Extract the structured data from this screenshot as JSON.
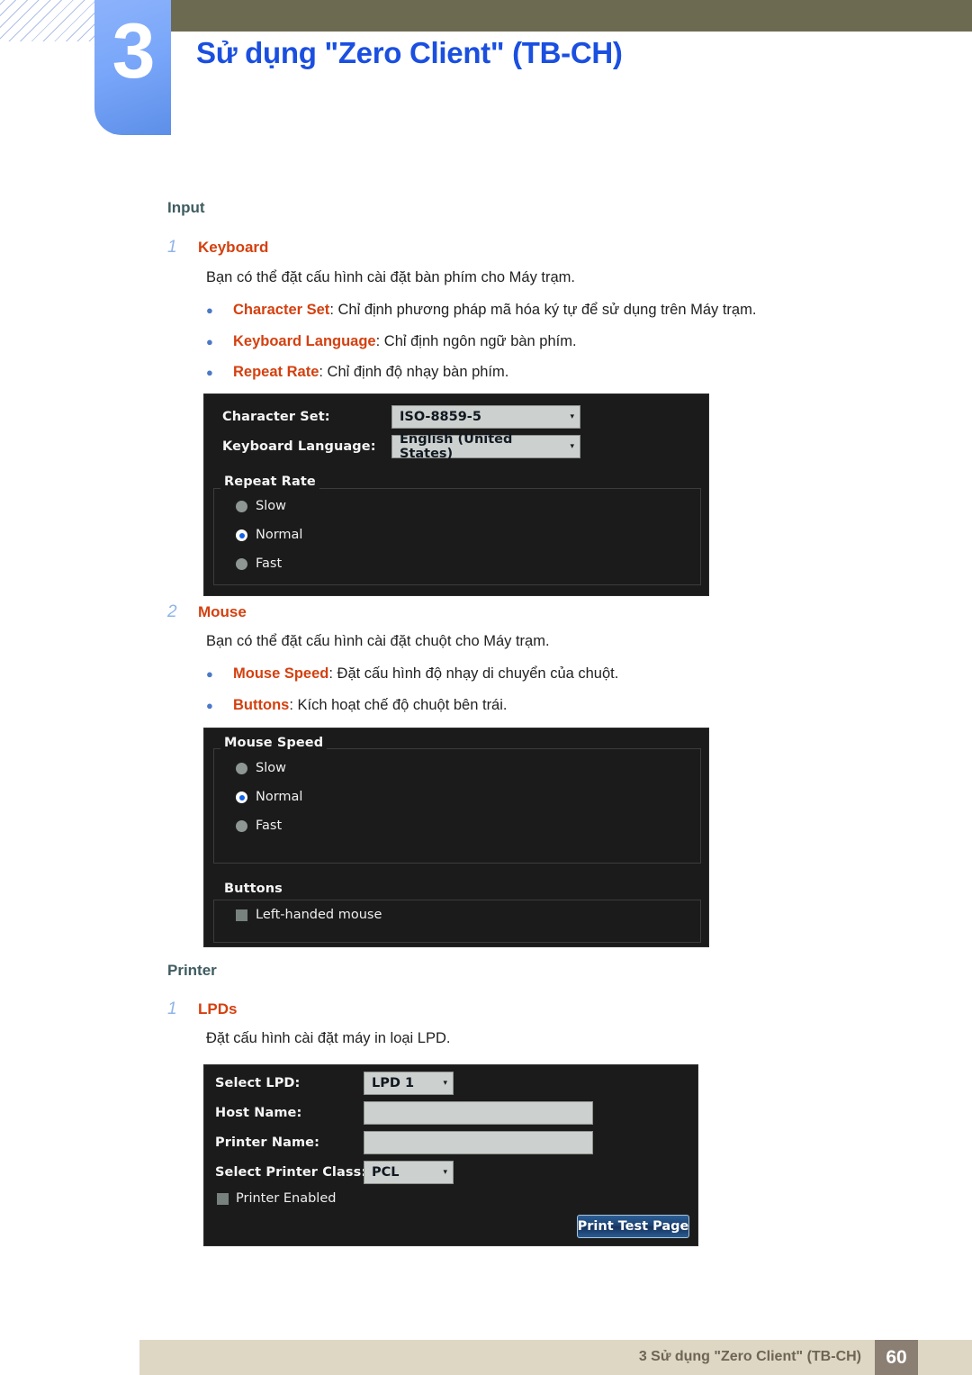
{
  "header": {
    "chapter_number": "3",
    "chapter_title": "Sử dụng \"Zero Client\" (TB-CH)",
    "accent_blue": "#1a4fe0",
    "olive": "#6d6a52"
  },
  "sections": [
    {
      "group_head": "Input",
      "items": [
        {
          "num": "1",
          "title": "Keyboard",
          "paragraph": "Bạn có thể đặt cấu hình cài đặt bàn phím cho Máy trạm.",
          "bullets": [
            {
              "term": "Character Set",
              "text": ": Chỉ định phương pháp mã hóa ký tự để sử dụng trên Máy trạm."
            },
            {
              "term": "Keyboard Language",
              "text": ": Chỉ định ngôn ngữ bàn phím."
            },
            {
              "term": "Repeat Rate",
              "text": ": Chỉ định độ nhạy bàn phím."
            }
          ]
        },
        {
          "num": "2",
          "title": "Mouse",
          "paragraph": "Bạn có thể đặt cấu hình cài đặt chuột cho Máy trạm.",
          "bullets": [
            {
              "term": "Mouse Speed",
              "text": ": Đặt cấu hình độ nhạy di chuyển của chuột."
            },
            {
              "term": "Buttons",
              "text": ": Kích hoạt chế độ chuột bên trái."
            }
          ]
        }
      ]
    },
    {
      "group_head": "Printer",
      "items": [
        {
          "num": "1",
          "title": "LPDs",
          "paragraph": "Đặt cấu hình cài đặt máy in loại LPD.",
          "bullets": []
        }
      ]
    }
  ],
  "keyboard_dialog": {
    "character_set_label": "Character Set:",
    "character_set_value": "ISO-8859-5",
    "keyboard_language_label": "Keyboard Language:",
    "keyboard_language_value": "English (United States)",
    "repeat_rate_legend": "Repeat Rate",
    "repeat_rate_options": [
      "Slow",
      "Normal",
      "Fast"
    ],
    "repeat_rate_selected": "Normal"
  },
  "mouse_dialog": {
    "mouse_speed_legend": "Mouse Speed",
    "mouse_speed_options": [
      "Slow",
      "Normal",
      "Fast"
    ],
    "mouse_speed_selected": "Normal",
    "buttons_legend": "Buttons",
    "left_handed_label": "Left-handed mouse",
    "left_handed_checked": false
  },
  "printer_dialog": {
    "select_lpd_label": "Select LPD:",
    "select_lpd_value": "LPD 1",
    "host_name_label": "Host Name:",
    "host_name_value": "",
    "printer_name_label": "Printer Name:",
    "printer_name_value": "",
    "printer_class_label": "Select Printer Class:",
    "printer_class_value": "PCL",
    "printer_enabled_label": "Printer Enabled",
    "printer_enabled_checked": false,
    "print_test_page_label": "Print Test Page"
  },
  "footer": {
    "text": "3 Sử dụng \"Zero Client\" (TB-CH)",
    "page_number": "60"
  },
  "icons": {
    "caret": "▾",
    "bullet": "●"
  }
}
